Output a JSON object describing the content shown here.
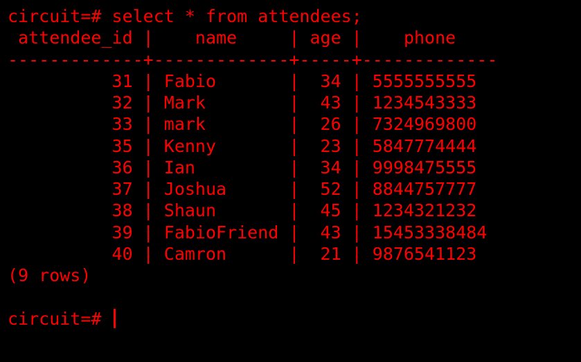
{
  "colors": {
    "background": "#000000",
    "foreground": "#ff0000"
  },
  "terminal": {
    "command_line": "circuit=# select * from attendees;",
    "header_line": " attendee_id |    name     | age |    phone",
    "separator_line": "-------------+-------------+-----+-------------",
    "rows": [
      "          31 | Fabio       |  34 | 5555555555",
      "          32 | Mark        |  43 | 1234543333",
      "          33 | mark        |  26 | 7324969800",
      "          35 | Kenny       |  23 | 5847774444",
      "          36 | Ian         |  34 | 9998475555",
      "          37 | Joshua      |  52 | 8844757777",
      "          38 | Shaun       |  45 | 1234321232",
      "          39 | FabioFriend |  43 | 15453338484",
      "          40 | Camron      |  21 | 9876541123"
    ],
    "row_count": "(9 rows)",
    "blank_line": "",
    "prompt": "circuit=# "
  }
}
